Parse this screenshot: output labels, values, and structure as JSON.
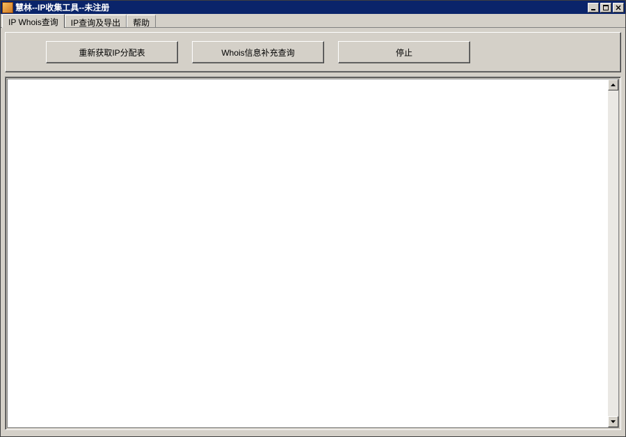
{
  "window": {
    "title": "慧林--IP收集工具--未注册"
  },
  "tabs": [
    {
      "label": "IP Whois查询",
      "active": true
    },
    {
      "label": "IP查询及导出",
      "active": false
    },
    {
      "label": "帮助",
      "active": false
    }
  ],
  "toolbar": {
    "refetch_label": "重新获取IP分配表",
    "whois_label": "Whois信息补充查询",
    "stop_label": "停止"
  },
  "content": {
    "text": ""
  }
}
